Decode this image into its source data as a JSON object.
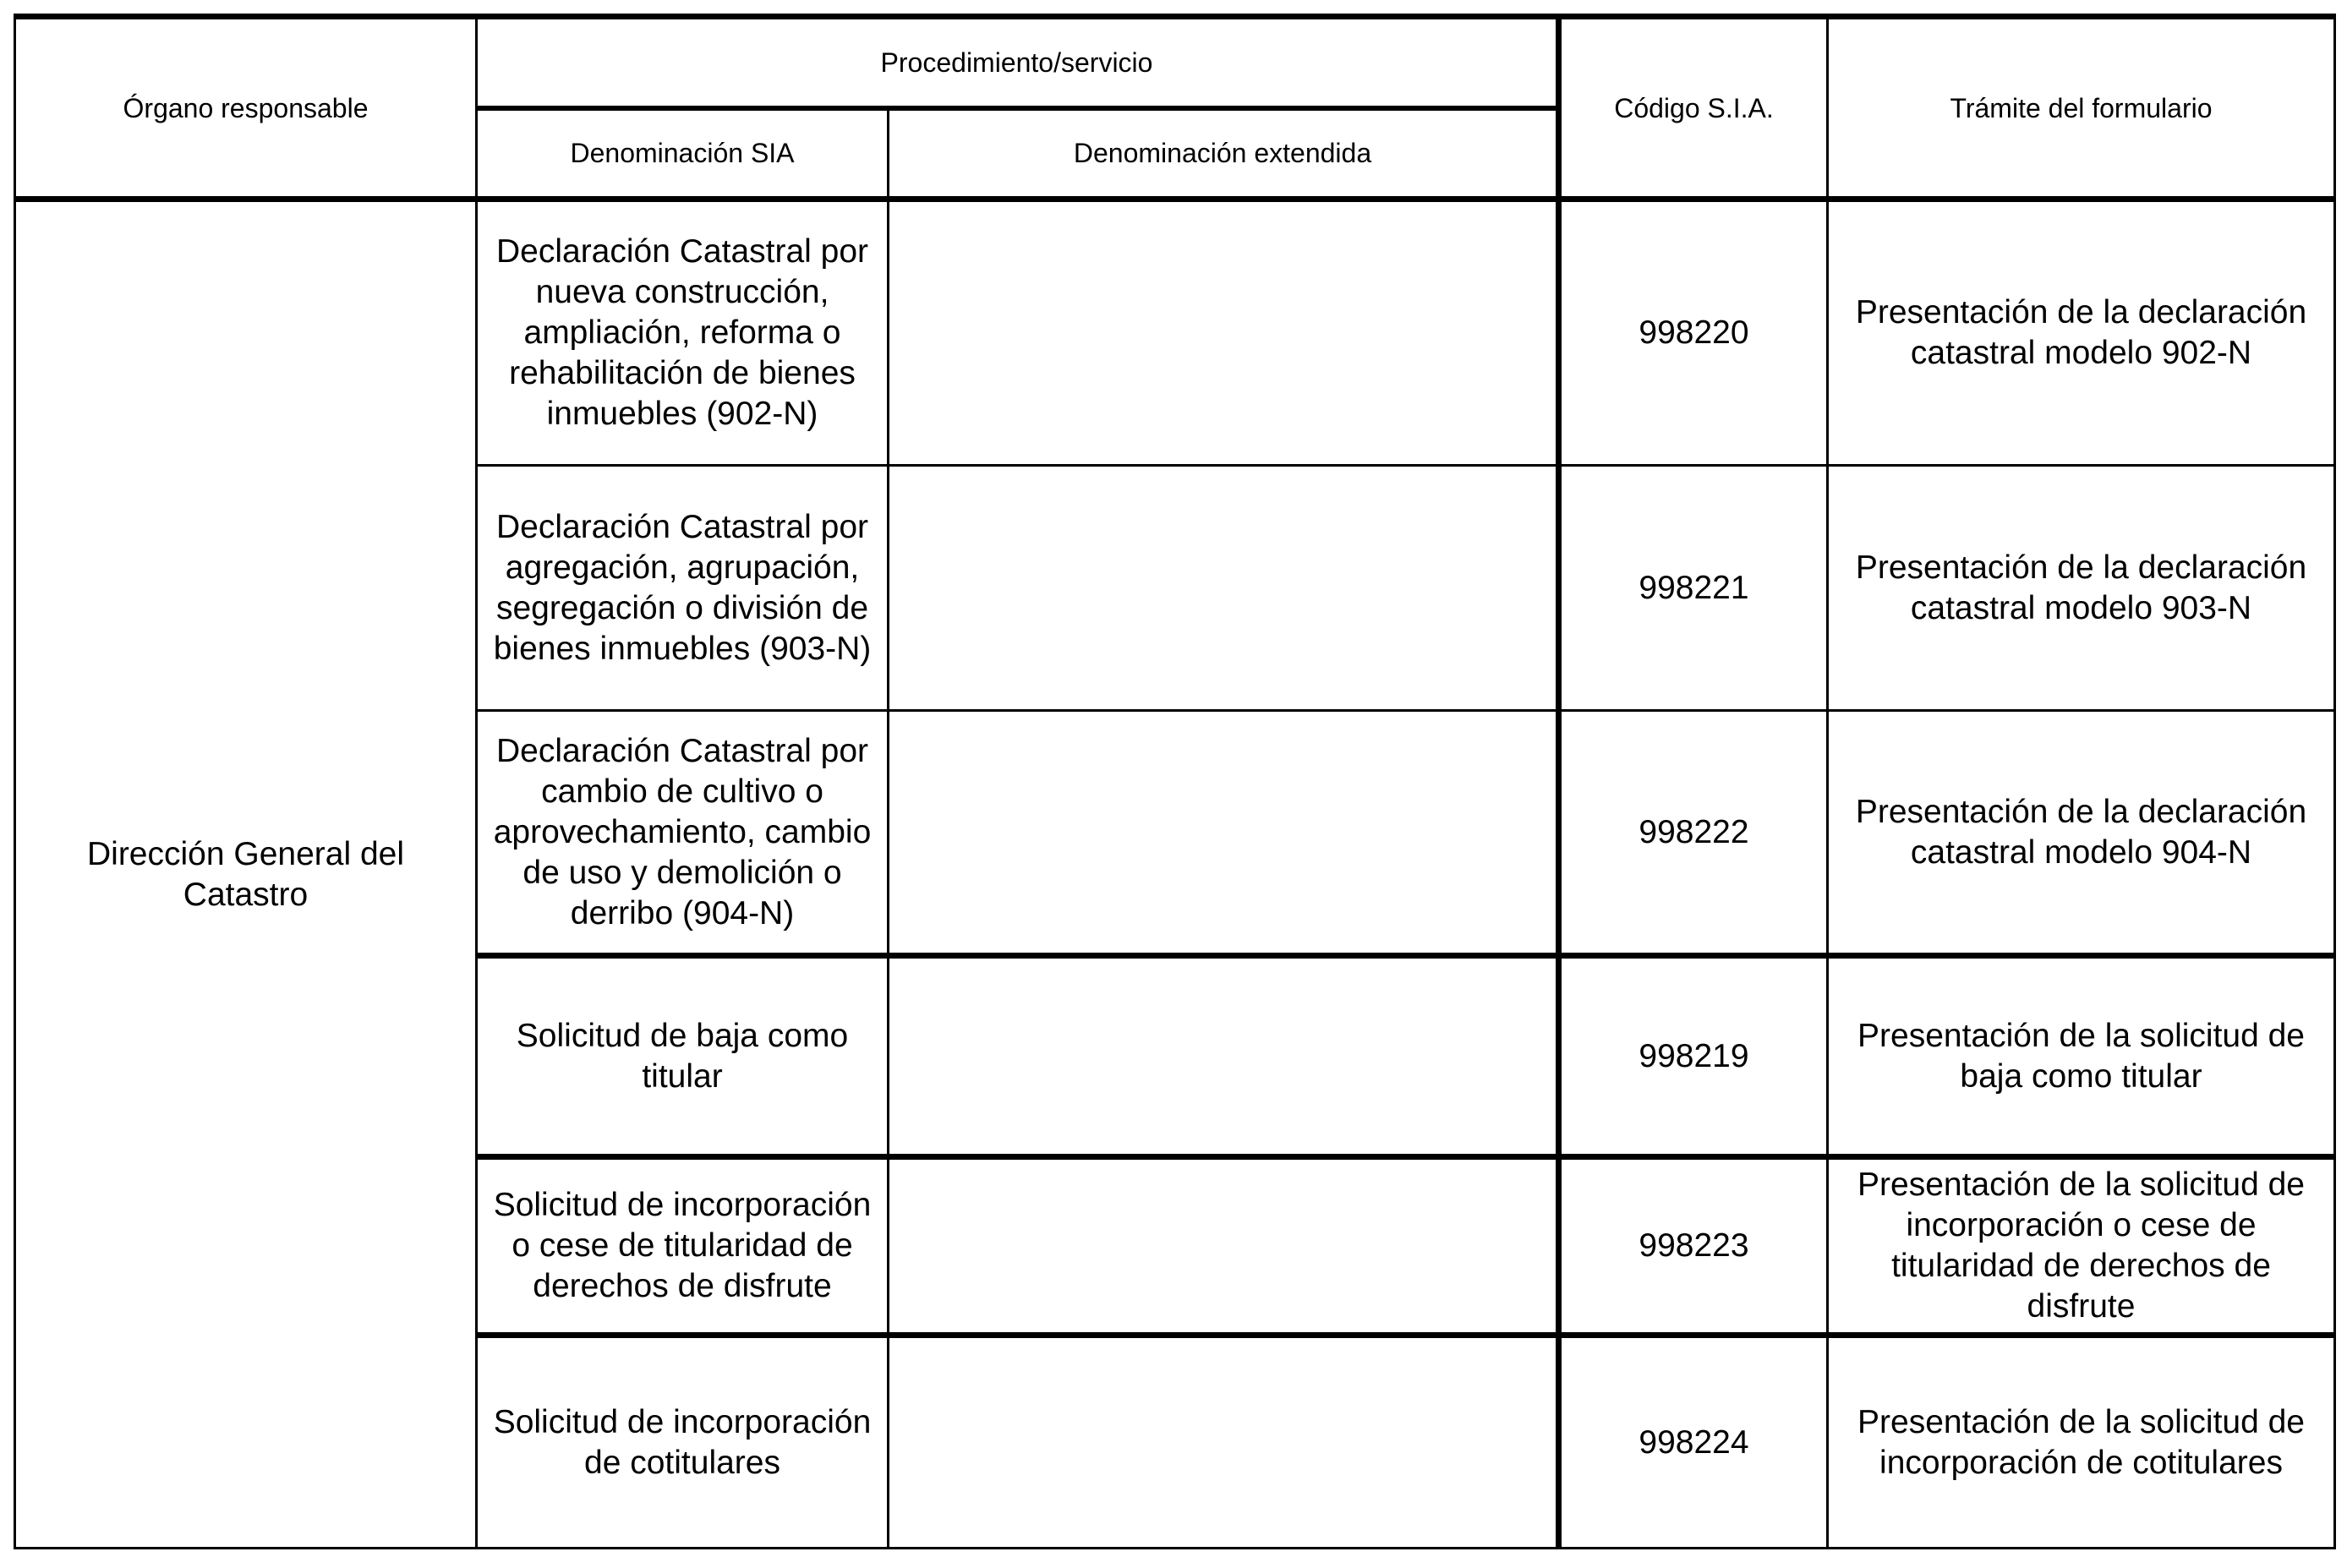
{
  "table": {
    "headers": {
      "organo": "Órgano responsable",
      "procedimiento": "Procedimiento/servicio",
      "denominacion_sia": "Denominación SIA",
      "denominacion_extendida": "Denominación extendida",
      "codigo": "Código S.I.A.",
      "tramite": "Trámite del formulario"
    },
    "organo_responsable": "Dirección General del Catastro",
    "rows": [
      {
        "denominacion_sia": "Declaración Catastral por nueva construcción, ampliación, reforma o rehabilitación de bienes inmuebles (902-N)",
        "denominacion_extendida": "",
        "codigo": "998220",
        "tramite": "Presentación de la declaración catastral modelo 902-N"
      },
      {
        "denominacion_sia": "Declaración Catastral por agregación, agrupación, segregación o división de bienes inmuebles (903-N)",
        "denominacion_extendida": "",
        "codigo": "998221",
        "tramite": "Presentación de la declaración catastral modelo 903-N"
      },
      {
        "denominacion_sia": "Declaración Catastral por cambio de cultivo o aprovechamiento, cambio de uso y demolición o derribo (904-N)",
        "denominacion_extendida": "",
        "codigo": "998222",
        "tramite": "Presentación de la declaración catastral modelo 904-N"
      },
      {
        "denominacion_sia": "Solicitud de baja como titular",
        "denominacion_extendida": "",
        "codigo": "998219",
        "tramite": "Presentación de la solicitud de baja como titular"
      },
      {
        "denominacion_sia": "Solicitud de incorporación o cese de titularidad de derechos de disfrute",
        "denominacion_extendida": "",
        "codigo": "998223",
        "tramite": "Presentación de la solicitud de incorporación o cese de titularidad de derechos de disfrute"
      },
      {
        "denominacion_sia": "Solicitud de incorporación de cotitulares",
        "denominacion_extendida": "",
        "codigo": "998224",
        "tramite": "Presentación de la solicitud de incorporación de cotitulares"
      }
    ]
  }
}
